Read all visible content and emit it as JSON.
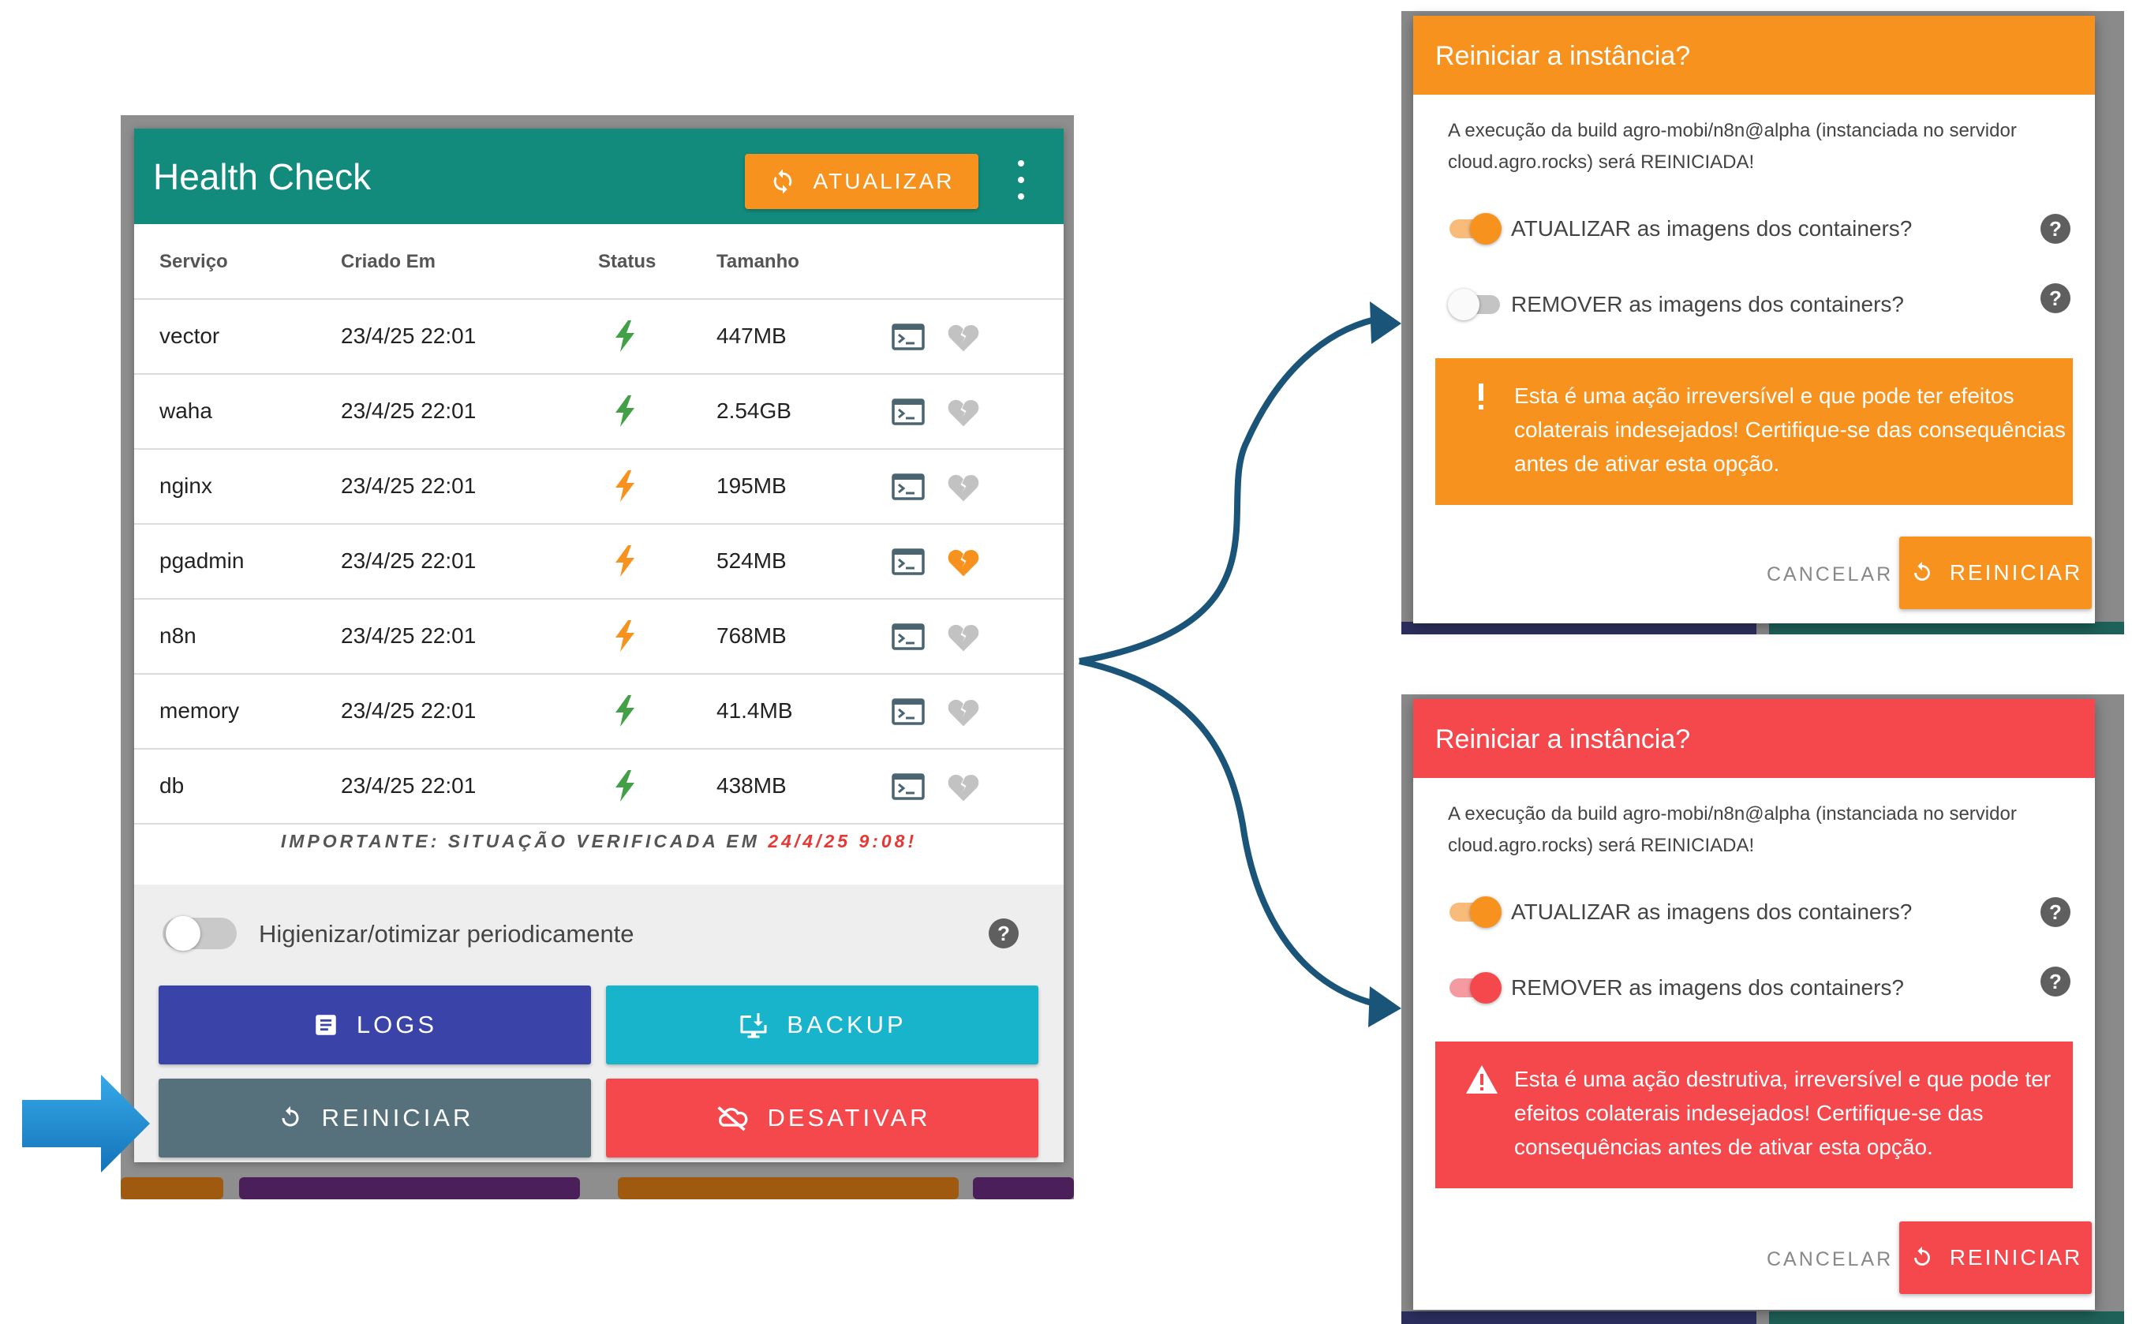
{
  "health_check": {
    "title": "Health Check",
    "update_label": "ATUALIZAR",
    "columns": [
      "Serviço",
      "Criado Em",
      "Status",
      "Tamanho"
    ],
    "rows": [
      {
        "service": "vector",
        "created": "23/4/25 22:01",
        "size": "447MB",
        "status_color": "#43a047",
        "heart_color": "#c2c2c2"
      },
      {
        "service": "waha",
        "created": "23/4/25 22:01",
        "size": "2.54GB",
        "status_color": "#43a047",
        "heart_color": "#c2c2c2"
      },
      {
        "service": "nginx",
        "created": "23/4/25 22:01",
        "size": "195MB",
        "status_color": "#f7921e",
        "heart_color": "#c2c2c2"
      },
      {
        "service": "pgadmin",
        "created": "23/4/25 22:01",
        "size": "524MB",
        "status_color": "#f7921e",
        "heart_color": "#f7921e"
      },
      {
        "service": "n8n",
        "created": "23/4/25 22:01",
        "size": "768MB",
        "status_color": "#f7921e",
        "heart_color": "#c2c2c2"
      },
      {
        "service": "memory",
        "created": "23/4/25 22:01",
        "size": "41.4MB",
        "status_color": "#43a047",
        "heart_color": "#c2c2c2"
      },
      {
        "service": "db",
        "created": "23/4/25 22:01",
        "size": "438MB",
        "status_color": "#43a047",
        "heart_color": "#c2c2c2"
      }
    ],
    "note_prefix": "IMPORTANTE:",
    "note_middle": " SITUAÇÃO VERIFICADA EM ",
    "note_date": "24/4/25 9:08",
    "note_suffix": "!",
    "toggle_label": "Higienizar/otimizar periodicamente",
    "buttons": {
      "logs": "LOGS",
      "backup": "BACKUP",
      "restart": "REINICIAR",
      "deactivate": "DESATIVAR"
    },
    "colors": {
      "header": "#128b7c",
      "accent": "#f7921e",
      "logs": "#3a44a8",
      "backup": "#18b4cc",
      "restart": "#56707c",
      "deactivate": "#f5484d"
    }
  },
  "dialog_warning": {
    "title": "Reiniciar a instância?",
    "message": "A execução da build agro-mobi/n8n@alpha (instanciada no servidor cloud.agro.rocks) será REINICIADA!",
    "option_update": "ATUALIZAR as imagens dos containers?",
    "option_update_on": true,
    "option_remove": "REMOVER as imagens dos containers?",
    "option_remove_on": false,
    "alert": "Esta é uma ação irreversível e que pode ter efeitos colaterais indesejados! Certifique-se das consequências antes de ativar esta opção.",
    "cancel": "CANCELAR",
    "confirm": "REINICIAR",
    "color": "#f7921e"
  },
  "dialog_danger": {
    "title": "Reiniciar a instância?",
    "message": "A execução da build agro-mobi/n8n@alpha (instanciada no servidor cloud.agro.rocks) será REINICIADA!",
    "option_update": "ATUALIZAR as imagens dos containers?",
    "option_update_on": true,
    "option_remove": "REMOVER as imagens dos containers?",
    "option_remove_on": true,
    "alert": "Esta é uma ação destrutiva, irreversível e que pode ter efeitos colaterais indesejados! Certifique-se das consequências antes de ativar esta opção.",
    "cancel": "CANCELAR",
    "confirm": "REINICIAR",
    "color": "#f5484d"
  }
}
